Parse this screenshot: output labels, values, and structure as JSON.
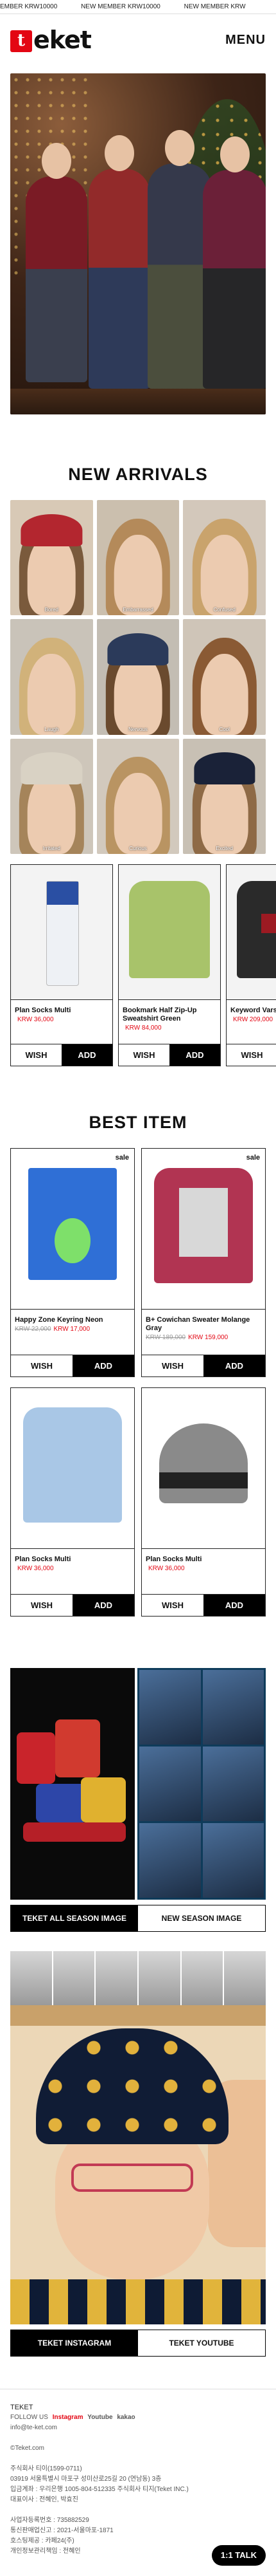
{
  "marquee": [
    "EMBER KRW10000",
    "NEW MEMBER KRW10000",
    "NEW MEMBER KRW"
  ],
  "header": {
    "logo_mark": "t",
    "logo_text": "eket",
    "menu_label": "MENU"
  },
  "new_arrivals": {
    "title": "NEW ARRIVALS",
    "tiles": [
      {
        "label": "Bored",
        "hat": "#b3262f",
        "hair": "#7a5a3c",
        "bg": "#d8c9b6"
      },
      {
        "label": "Embarrassed",
        "hat": "",
        "hair": "#b48a5a",
        "bg": "#cbbfae"
      },
      {
        "label": "Confused",
        "hat": "",
        "hair": "#c9a36c",
        "bg": "#d3c8bb"
      },
      {
        "label": "Laugh",
        "hat": "",
        "hair": "#d1b27a",
        "bg": "#c9c3b9"
      },
      {
        "label": "Nervous",
        "hat": "#2b3a5a",
        "hair": "#6a4a2e",
        "bg": "#c3bdb3"
      },
      {
        "label": "Cool",
        "hat": "",
        "hair": "#8a5a34",
        "bg": "#cfc5b8"
      },
      {
        "label": "Irritated",
        "hat": "#d9d2c4",
        "hair": "#a5845a",
        "bg": "#cec6ba"
      },
      {
        "label": "Curious",
        "hat": "",
        "hair": "#b99462",
        "bg": "#d2c9bd"
      },
      {
        "label": "Excited",
        "hat": "#1a2238",
        "hair": "#8e6a46",
        "bg": "#c8c0b4"
      }
    ],
    "products": [
      {
        "name": "Plan Socks Multi",
        "price": "KRW 36,000",
        "old_price": ""
      },
      {
        "name": "Bookmark Half Zip-Up Sweatshirt Green",
        "price": "KRW 84,000",
        "old_price": ""
      },
      {
        "name": "Keyword Varsity Jacket",
        "price": "KRW 209,000",
        "old_price": ""
      }
    ]
  },
  "best_item": {
    "title": "BEST ITEM",
    "products": [
      {
        "name": "Happy Zone Keyring Neon",
        "price": "KRW 17,000",
        "old_price": "KRW 22,000",
        "tag": "sale"
      },
      {
        "name": "B+ Cowichan Sweater Molange Gray",
        "price": "KRW 159,000",
        "old_price": "KRW 189,000",
        "tag": "sale"
      },
      {
        "name": "Plan Socks Multi",
        "price": "KRW 36,000",
        "old_price": "",
        "tag": ""
      },
      {
        "name": "Plan Socks Multi",
        "price": "KRW 36,000",
        "old_price": "",
        "tag": ""
      }
    ]
  },
  "buttons": {
    "wish": "WISH",
    "add": "ADD"
  },
  "season": {
    "tab_all": "TEKET ALL SEASON IMAGE",
    "tab_new": "NEW SEASON IMAGE"
  },
  "social": {
    "tab_insta": "TEKET INSTAGRAM",
    "tab_youtube": "TEKET YOUTUBE"
  },
  "footer": {
    "brand": "TEKET",
    "follow_label": "FOLLOW US",
    "links": [
      "Instagram",
      "Youtube",
      "kakao"
    ],
    "email": "info@te-ket.com",
    "copyright": "©Teket.com",
    "lines_a": [
      "주식회사 티이(1599-0711)",
      "03919 서울특별시 마포구 성미산로25길 20 (연남동) 3층",
      "입금계좌 : 우리은행 1005-804-512335 주식회사 티지(Teket INC.)",
      "대표이사 : 전혜인, 박효진"
    ],
    "lines_b": [
      "사업자등록번호 : 735882529",
      "통신판매업신고 : 2021-서울마포-1871",
      "호스팅제공 : 카페24(주)",
      "개인정보관리책임 : 전혜인"
    ],
    "talk_button": "1:1 TALK"
  },
  "colors": {
    "accent": "#e30613",
    "dark": "#000000"
  }
}
